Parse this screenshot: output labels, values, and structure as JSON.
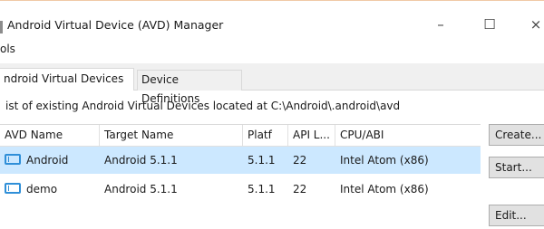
{
  "window": {
    "title": "Android Virtual Device (AVD) Manager",
    "controls": {
      "minimize": "–",
      "maximize": "☐",
      "close": "×"
    }
  },
  "menu": {
    "items": [
      {
        "label": "ols"
      }
    ]
  },
  "tabs": [
    {
      "label": "ndroid Virtual Devices",
      "active": true
    },
    {
      "label": "Device Definitions",
      "active": false
    }
  ],
  "path_label": "ist of existing Android Virtual Devices located at C:\\Android\\.android\\avd",
  "table": {
    "columns": [
      "AVD Name",
      "Target Name",
      "Platf",
      "API L...",
      "CPU/ABI"
    ],
    "rows": [
      {
        "name": "Android",
        "target": "Android 5.1.1",
        "platform": "5.1.1",
        "api": "22",
        "cpu": "Intel Atom (x86)",
        "selected": true,
        "icon": "device-screen-icon"
      },
      {
        "name": "demo",
        "target": "Android 5.1.1",
        "platform": "5.1.1",
        "api": "22",
        "cpu": "Intel Atom (x86)",
        "selected": false,
        "icon": "device-screen-icon"
      }
    ]
  },
  "actions": {
    "create": "Create...",
    "start": "Start...",
    "edit": "Edit..."
  },
  "colors": {
    "selection": "#cce8ff",
    "icon": "#2f8fd8",
    "tab_bg": "#f0f0f0",
    "button_bg": "#e1e1e1"
  }
}
